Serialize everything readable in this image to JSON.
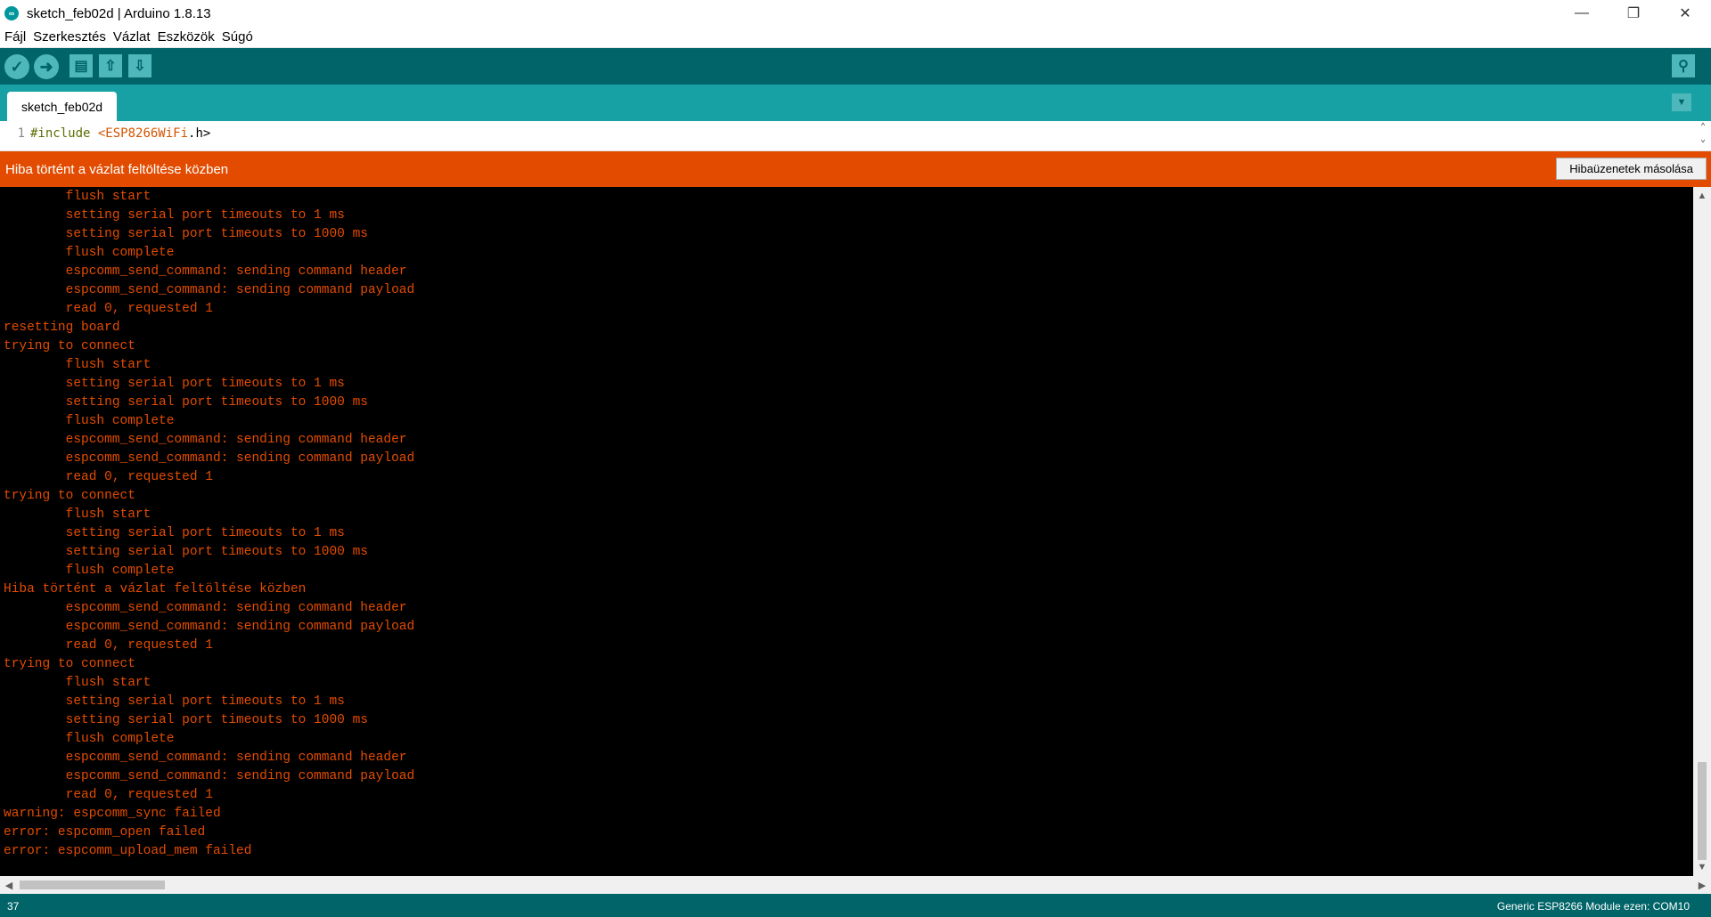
{
  "window": {
    "title": "sketch_feb02d | Arduino 1.8.13",
    "app_icon": "arduino-icon",
    "controls": [
      "minimize-icon",
      "restore-icon",
      "close-icon"
    ]
  },
  "menu": [
    "Fájl",
    "Szerkesztés",
    "Vázlat",
    "Eszközök",
    "Súgó"
  ],
  "toolbar": {
    "buttons": [
      "verify-icon",
      "upload-icon",
      "new-icon",
      "open-icon",
      "save-icon"
    ],
    "serial_monitor": "serial-monitor-icon"
  },
  "tabs": [
    {
      "label": "sketch_feb02d"
    }
  ],
  "editor": {
    "line_number": "1",
    "code_keyword": "#include ",
    "code_lib_open": "<",
    "code_lib": "ESP8266WiFi",
    "code_lib_close": ".h>"
  },
  "error_bar": {
    "message": "Hiba történt a vázlat feltöltése közben",
    "copy_button": "Hibaüzenetek másolása",
    "color": "#e34c00"
  },
  "console_lines": [
    "        flush start",
    "        setting serial port timeouts to 1 ms",
    "        setting serial port timeouts to 1000 ms",
    "        flush complete",
    "        espcomm_send_command: sending command header",
    "        espcomm_send_command: sending command payload",
    "        read 0, requested 1",
    "resetting board",
    "trying to connect",
    "        flush start",
    "        setting serial port timeouts to 1 ms",
    "        setting serial port timeouts to 1000 ms",
    "        flush complete",
    "        espcomm_send_command: sending command header",
    "        espcomm_send_command: sending command payload",
    "        read 0, requested 1",
    "trying to connect",
    "        flush start",
    "        setting serial port timeouts to 1 ms",
    "        setting serial port timeouts to 1000 ms",
    "        flush complete",
    "Hiba történt a vázlat feltöltése közben",
    "        espcomm_send_command: sending command header",
    "        espcomm_send_command: sending command payload",
    "        read 0, requested 1",
    "trying to connect",
    "        flush start",
    "        setting serial port timeouts to 1 ms",
    "        setting serial port timeouts to 1000 ms",
    "        flush complete",
    "        espcomm_send_command: sending command header",
    "        espcomm_send_command: sending command payload",
    "        read 0, requested 1",
    "warning: espcomm_sync failed",
    "error: espcomm_open failed",
    "error: espcomm_upload_mem failed"
  ],
  "status": {
    "line": "37",
    "board": "Generic ESP8266 Module ezen: COM10"
  },
  "colors": {
    "toolbar": "#006468",
    "tabs": "#17a1a5",
    "console_text": "#e34c00"
  }
}
